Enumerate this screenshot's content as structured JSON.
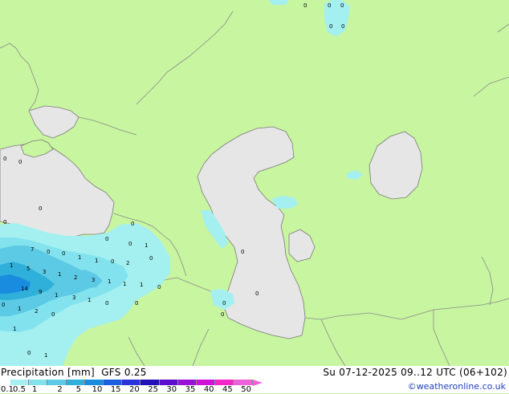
{
  "header": {
    "product": "Precipitation [mm]",
    "model": "GFS 0.25",
    "valid_time": "Su 07-12-2025 09..12 UTC (06+102)"
  },
  "footer": {
    "credit": "©weatheronline.co.uk"
  },
  "legend": {
    "ticks": [
      "0.1",
      "0.5",
      "1",
      "2",
      "5",
      "10",
      "15",
      "20",
      "25",
      "30",
      "35",
      "40",
      "45",
      "50"
    ],
    "colors": [
      "#a4f0f0",
      "#82e2ee",
      "#5ccae4",
      "#2eb0da",
      "#1a8ce0",
      "#1a5ee0",
      "#2a32dc",
      "#2410b8",
      "#5c0ccc",
      "#9a10d8",
      "#d012d8",
      "#f028c8",
      "#f060d8"
    ]
  },
  "colors": {
    "land": "#c8f5a0",
    "water": "#e6e6e6",
    "border": "#9a9a9a",
    "coast": "#7a7a7a"
  },
  "precip_labels": [
    "0",
    "0",
    "0",
    "0",
    "0",
    "0",
    "0",
    "0",
    "0",
    "0",
    "7",
    "0",
    "0",
    "1",
    "1",
    "0",
    "2",
    "0",
    "1",
    "1",
    "5",
    "3",
    "1",
    "2",
    "3",
    "1",
    "1",
    "1",
    "0",
    "14",
    "9",
    "1",
    "3",
    "1",
    "0",
    "1",
    "2",
    "0",
    "0",
    "1",
    "1",
    "0",
    "0",
    "0",
    "0",
    "0",
    "0",
    "0",
    "0"
  ]
}
